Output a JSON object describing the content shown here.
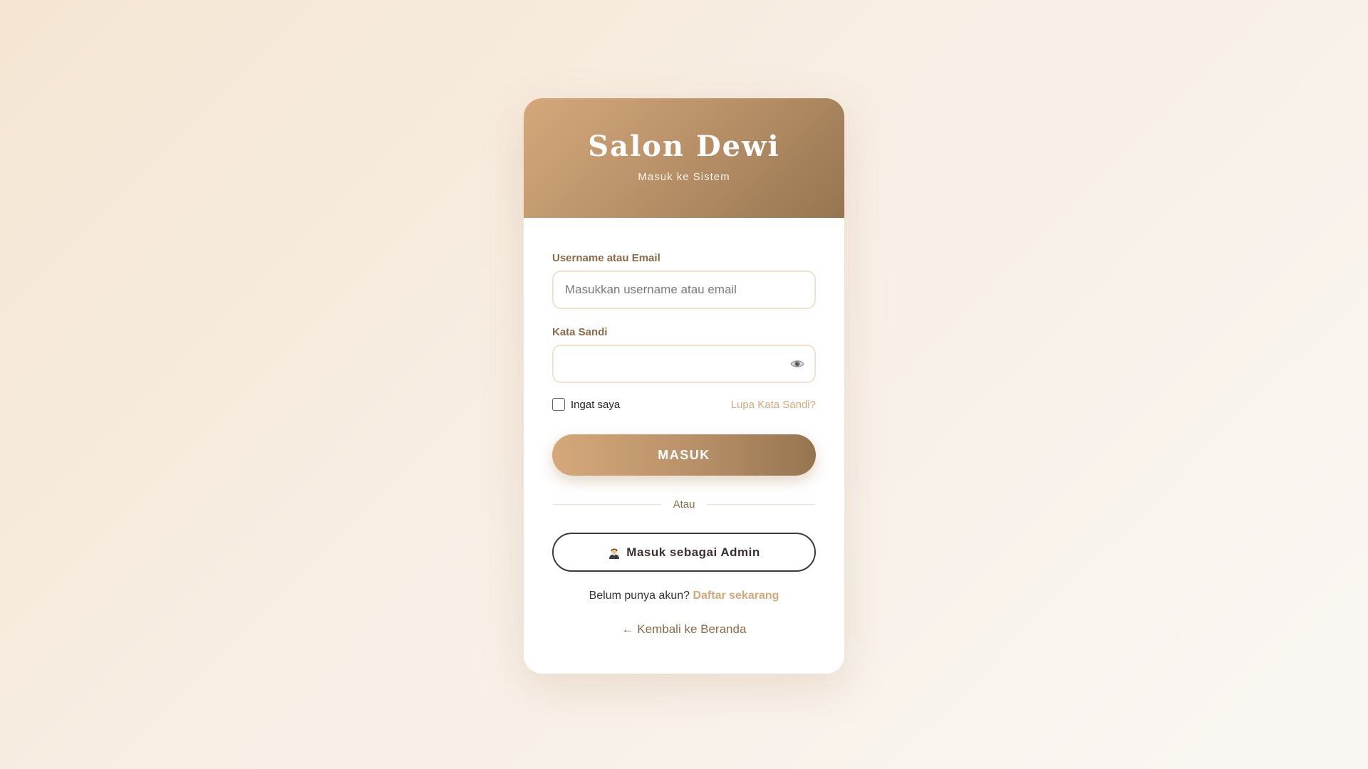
{
  "header": {
    "title": "Salon Dewi",
    "subtitle": "Masuk ke Sistem"
  },
  "form": {
    "username": {
      "label": "Username atau Email",
      "placeholder": "Masukkan username atau email",
      "value": ""
    },
    "password": {
      "label": "Kata Sandi",
      "placeholder": "",
      "value": "",
      "toggle_icon": "eye-icon"
    },
    "remember": {
      "label": "Ingat saya",
      "checked": false
    },
    "forgot_label": "Lupa Kata Sandi?",
    "submit_label": "MASUK",
    "divider_label": "Atau",
    "admin_label": "Masuk sebagai Admin",
    "admin_icon": "admin-person-icon"
  },
  "footer": {
    "register_prompt": "Belum punya akun?",
    "register_link": "Daftar sekarang",
    "back_label": "← Kembali ke Beranda"
  },
  "colors": {
    "accent": "#d4a87a",
    "accent_dark": "#957550",
    "label": "#8b6b47"
  }
}
